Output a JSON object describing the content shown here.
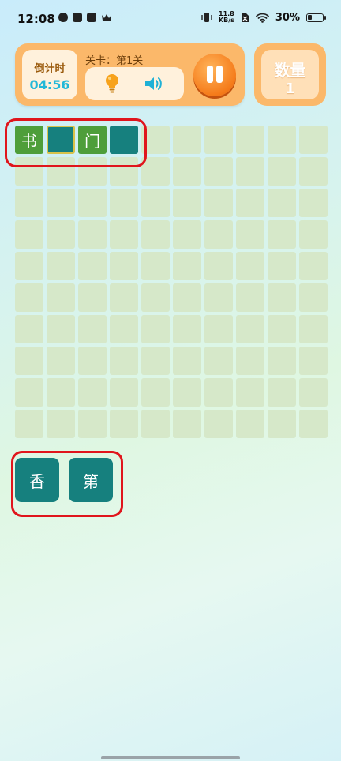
{
  "status_bar": {
    "time": "12:08",
    "speed_value": "11.8",
    "speed_unit": "KB/s",
    "battery": "30%",
    "battery_level": 0.3
  },
  "game": {
    "countdown_label": "倒计时",
    "countdown_value": "04:56",
    "level_text": "关卡：第1关",
    "quantity_label": "数量",
    "quantity_value": "1"
  },
  "grid": {
    "columns": 10,
    "rows": 10,
    "filled_cells": [
      {
        "index": 0,
        "char": "书",
        "style": "green"
      },
      {
        "index": 1,
        "char": "",
        "style": "teal",
        "selected": true
      },
      {
        "index": 2,
        "char": "门",
        "style": "green"
      },
      {
        "index": 3,
        "char": "",
        "style": "teal"
      }
    ]
  },
  "choices": [
    {
      "char": "香"
    },
    {
      "char": "第"
    }
  ],
  "colors": {
    "panel": "#fbb86a",
    "tile_empty": "#d6e8c9",
    "tile_green": "#4e9e3a",
    "tile_teal": "#16807e",
    "highlight": "#e0151c",
    "timer_text": "#22b8d8"
  },
  "icons": [
    "check-circle-icon",
    "play-icon",
    "mail-icon",
    "crown-icon",
    "vibrate-icon",
    "sim-icon",
    "wifi-icon",
    "battery-icon",
    "bulb-icon",
    "speaker-icon",
    "pause-icon"
  ]
}
